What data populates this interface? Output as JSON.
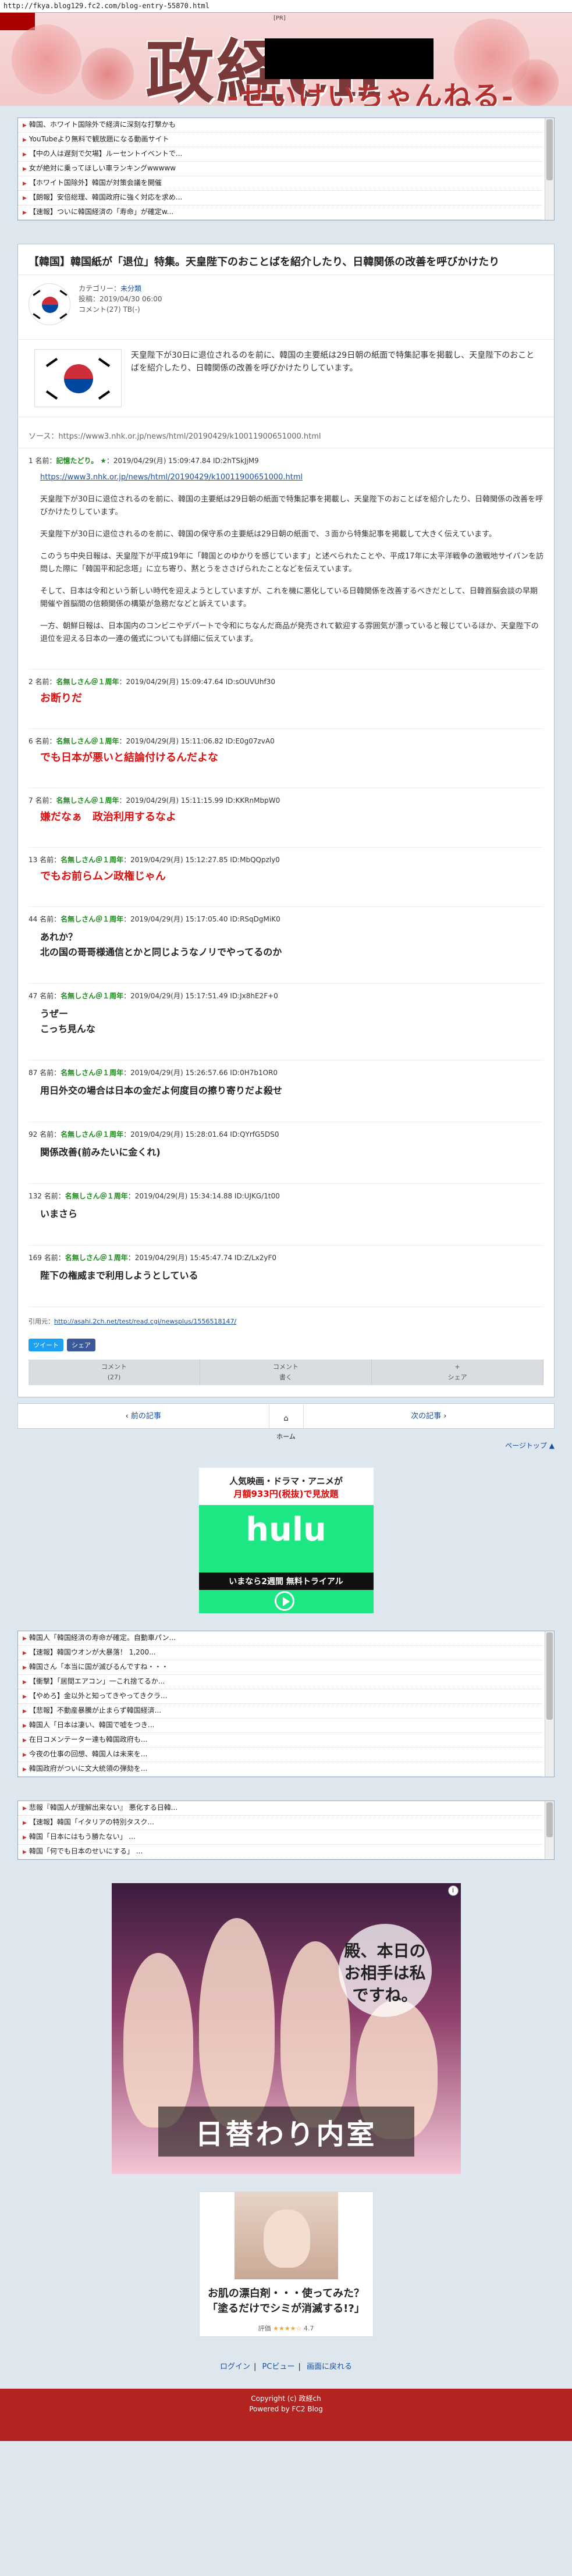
{
  "browser": {
    "url": "http://fkya.blog129.fc2.com/blog-entry-55870.html"
  },
  "header": {
    "title": "政経ch",
    "subtitle": "-せいけいちゃんねる-",
    "top_tag": "[PR]"
  },
  "top_links": [
    "韓国、ホワイト国除外で経済に深刻な打撃かも",
    "YouTubeより無料で観放題になる動画サイト",
    "【中の人は遅刻で欠場】ルーセントイベントで...",
    "女が絶対に乗ってほしい車ランキングwwwww",
    "【ホワイト国除外】韓国が対策会議を開催",
    "【朗報】安倍総理、韓国政府に強く対応を求め...",
    "【速報】ついに韓国経済の「寿命」が確定w..."
  ],
  "article": {
    "title": "【韓国】韓国紙が「退位」特集。天皇陛下のおことばを紹介したり、日韓関係の改善を呼びかけたり",
    "category_label": "カテゴリー：",
    "category": "未分類",
    "posted": "投稿：2019/04/30 06:00",
    "comments": "コメント(27) TB(-)",
    "intro": "天皇陛下が30日に退位されるのを前に、韓国の主要紙は29日朝の紙面で特集記事を掲載し、天皇陛下のおことばを紹介したり、日韓関係の改善を呼びかけたりしています。",
    "source": "ソース：https://www3.nhk.or.jp/news/html/20190429/k10011900651000.html"
  },
  "posts": [
    {
      "num": "1",
      "head_label": "名前：",
      "name": "記憶たどり。",
      "star": "★",
      "meta": "：2019/04/29(月) 15:09:47.84 ID:2hTSkJjM9",
      "link": "https://www3.nhk.or.jp/news/html/20190429/k10011900651000.html",
      "paragraphs": [
        "天皇陛下が30日に退位されるのを前に、韓国の主要紙は29日朝の紙面で特集記事を掲載し、天皇陛下のおことばを紹介したり、日韓関係の改善を呼びかけたりしています。",
        "天皇陛下が30日に退位されるのを前に、韓国の保守系の主要紙は29日朝の紙面で、３面から特集記事を掲載して大きく伝えています。",
        "このうち中央日報は、天皇陛下が平成19年に「韓国とのゆかりを感じています」と述べられたことや、平成17年に太平洋戦争の激戦地サイパンを訪問した際に「韓国平和記念塔」に立ち寄り、黙とうをささげられたことなどを伝えています。",
        "そして、日本は令和という新しい時代を迎えようとしていますが、これを機に悪化している日韓関係を改善するべきだとして、日韓首脳会談の早期開催や首脳間の信頼関係の構築が急務だなどと訴えています。",
        "一方、朝鮮日報は、日本国内のコンビニやデパートで令和にちなんだ商品が発売されて歓迎する雰囲気が漂っていると報じているほか、天皇陛下の退位を迎える日本の一連の儀式についても詳細に伝えています。"
      ]
    },
    {
      "num": "2",
      "head_label": "名前：",
      "name": "名無しさん＠１周年",
      "meta": "：2019/04/29(月) 15:09:47.64 ID:sOUVUhf30",
      "text": "お断りだ",
      "style": "red"
    },
    {
      "num": "6",
      "head_label": "名前：",
      "name": "名無しさん＠１周年",
      "meta": "：2019/04/29(月) 15:11:06.82 ID:E0g07zvA0",
      "text": "でも日本が悪いと結論付けるんだよな",
      "style": "red"
    },
    {
      "num": "7",
      "head_label": "名前：",
      "name": "名無しさん＠１周年",
      "meta": "：2019/04/29(月) 15:11:15.99 ID:KKRnMbpW0",
      "text": "嫌だなぁ　政治利用するなよ",
      "style": "red"
    },
    {
      "num": "13",
      "head_label": "名前：",
      "name": "名無しさん＠１周年",
      "meta": "：2019/04/29(月) 15:12:27.85 ID:MbQQpzly0",
      "text": "でもお前らムン政権じゃん",
      "style": "red"
    },
    {
      "num": "44",
      "head_label": "名前：",
      "name": "名無しさん＠１周年",
      "meta": "：2019/04/29(月) 15:17:05.40 ID:RSqDgMiK0",
      "text": "あれか？\n北の国の哥哥様通信とかと同じようなノリでやってるのか",
      "style": "blk"
    },
    {
      "num": "47",
      "head_label": "名前：",
      "name": "名無しさん＠１周年",
      "meta": "：2019/04/29(月) 15:17:51.49 ID:Jx8hE2F+0",
      "text": "うぜー\nこっち見んな",
      "style": "blk"
    },
    {
      "num": "87",
      "head_label": "名前：",
      "name": "名無しさん＠１周年",
      "meta": "：2019/04/29(月) 15:26:57.66 ID:0H7b1OR0",
      "text": "用日外交の場合は日本の金だよ何度目の擦り寄りだよ殺せ",
      "style": "blk"
    },
    {
      "num": "92",
      "head_label": "名前：",
      "name": "名無しさん＠１周年",
      "meta": "：2019/04/29(月) 15:28:01.64 ID:QYrfG5DS0",
      "text": "関係改善(前みたいに金くれ)",
      "style": "blk"
    },
    {
      "num": "132",
      "head_label": "名前：",
      "name": "名無しさん＠１周年",
      "meta": "：2019/04/29(月) 15:34:14.88 ID:UJKG/1t00",
      "text": "いまさら",
      "style": "blk"
    },
    {
      "num": "169",
      "head_label": "名前：",
      "name": "名無しさん＠１周年",
      "meta": "：2019/04/29(月) 15:45:47.74 ID:Z/Lx2yF0",
      "text": "陛下の権威まで利用しようとしている",
      "style": "blk"
    }
  ],
  "source_line": {
    "label": "引用元：",
    "link": "http://asahi.2ch.net/test/read.cgi/newsplus/1556518147/"
  },
  "social": {
    "tweet": "ツイート",
    "share": "シェア"
  },
  "actions": {
    "comment": "コメント\n(27)",
    "comment2": "コメント\n書く",
    "share": "+\nシェア"
  },
  "pager": {
    "prev": "前の記事",
    "home": "ホーム",
    "next": "次の記事"
  },
  "page_top": "ページトップ",
  "hulu_ad": {
    "line1": "人気映画・ドラマ・アニメが",
    "line2": "月額933円(税抜)で見放題",
    "logo": "hulu",
    "cta": "いまなら2週間 無料トライアル"
  },
  "middle_links": [
    "韓国人「韓国経済の寿命が確定。自動車パン...",
    "【速報】韓国ウオンが大暴落！ 1,200...",
    "韓国さん「本当に国が滅びるんですね・・・",
    "【衝撃】「居間エアコン」一これ捨てるか...",
    "【やめろ】金以外と知ってきやってきクラ...",
    "【悲報】不動産暴騰が止まらず韓国経済...",
    "韓国人「日本は凄い、韓国で嘘をつき...",
    "在日コメンテーター達も韓国政府も...",
    "今夜の仕事の回想、韓国人は未来を...",
    "韓国政府がついに文大統領の弾劾を..."
  ],
  "lower_links": [
    "悲報『韓国人が理解出来ない』 悪化する日韓...",
    "【速報】韓国「イタリアの特別タスク...",
    "韓国「日本にはもう勝たない」 ...",
    "韓国「何でも日本のせいにする」 ..."
  ],
  "big_ad": {
    "bubble": "殿、本日のお相手は私ですね。",
    "brand": "日替わり内室",
    "info": "i"
  },
  "small_ad": {
    "caption": "お肌の漂白剤・・・使ってみた？\n「塗るだけでシミが消滅する!?」",
    "rating_label": "評価",
    "stars": "★★★★☆",
    "rating_value": "4.7"
  },
  "footer": {
    "links": [
      "ログイン",
      "PCビュー",
      "画面に戻れる"
    ],
    "copyright": "Copyright (c) 政経ch",
    "powered": "Powered by FC2 Blog"
  }
}
